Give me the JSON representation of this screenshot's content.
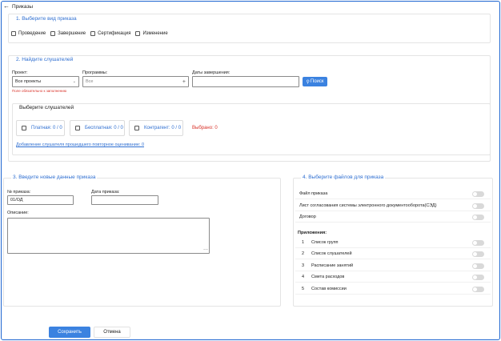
{
  "header": {
    "back_icon": "arrow-left-icon",
    "title": "Приказы"
  },
  "section1": {
    "title": "1. Выберите вид приказа",
    "options": [
      {
        "label": "Проведение",
        "checked": false
      },
      {
        "label": "Завершение",
        "checked": false
      },
      {
        "label": "Сертификация",
        "checked": false
      },
      {
        "label": "Изменение",
        "checked": false
      }
    ]
  },
  "section2": {
    "title": "2. Найдите слушателей",
    "project_label": "Проект:",
    "project_value": "Все проекты",
    "project_required": "Поле обязательно к заполнению",
    "programs_label": "Программы:",
    "programs_placeholder": "Все",
    "programs_plus": "+",
    "end_dates_label": "Даты завершения:",
    "end_dates_value": "",
    "search_button": "Поиск",
    "listeners": {
      "title": "Выберите слушателей",
      "paid": "Платная: 0 / 0",
      "free": "Бесплатная: 0 / 0",
      "contractor": "Контрагент: 0 / 0",
      "selected": "Выбрано: 0",
      "add_link": "Добавление слушателя прошедшего повторное оценивание: 0"
    }
  },
  "section3": {
    "title": "3. Введите новые данные приказа",
    "order_no_label": "№ приказа:",
    "order_no_value": "01/ОД",
    "date_label": "Дата приказа:",
    "date_value": "",
    "description_label": "Описание:",
    "description_value": ""
  },
  "section4": {
    "title": "4. Выберите файлов для приказа",
    "files": [
      {
        "name": "Файл приказа",
        "on": false
      },
      {
        "name": "Лист согласования системы электронного документооборота(СЭД)",
        "on": false
      },
      {
        "name": "Договор",
        "on": false
      }
    ],
    "appendix_label": "Приложения:",
    "appendices": [
      {
        "num": "1",
        "name": "Список групп",
        "on": false
      },
      {
        "num": "2",
        "name": "Список слушателей",
        "on": false
      },
      {
        "num": "3",
        "name": "Расписание занятий",
        "on": false
      },
      {
        "num": "4",
        "name": "Смета расходов",
        "on": false
      },
      {
        "num": "5",
        "name": "Состав комиссии",
        "on": false
      }
    ]
  },
  "footer": {
    "save": "Сохранить",
    "cancel": "Отмена"
  },
  "colors": {
    "accent": "#3b82e0",
    "title_blue": "#2f6fd1",
    "error_red": "#d9342b",
    "frame": "#1e66d0"
  }
}
